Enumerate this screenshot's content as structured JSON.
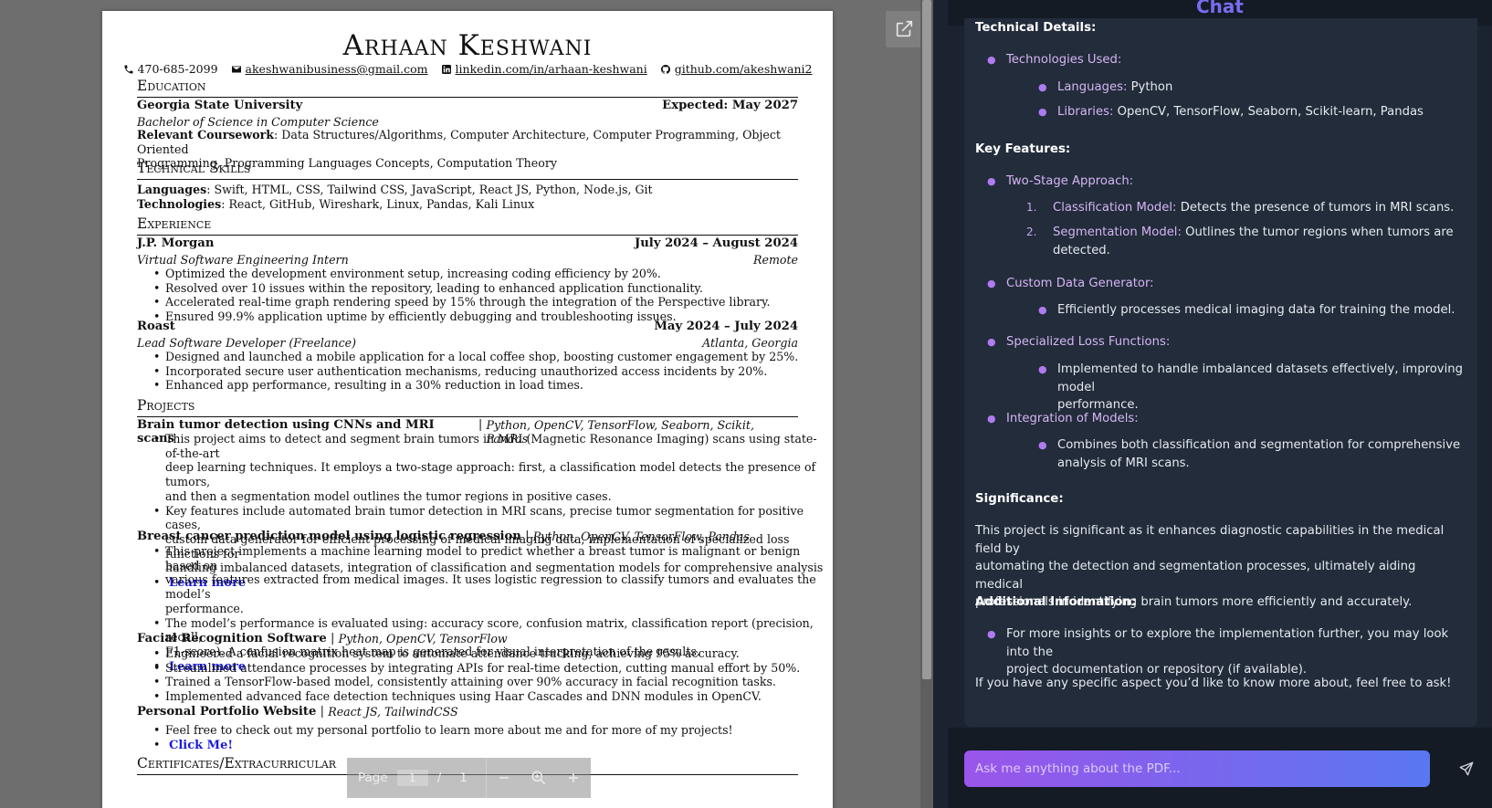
{
  "viewer": {
    "resume": {
      "name": "Arhaan Keshwani",
      "contact": {
        "phone": "470-685-2099",
        "email": "akeshwanibusiness@gmail.com",
        "linkedin": "linkedin.com/in/arhaan-keshwani",
        "github": "github.com/akeshwani2"
      },
      "education": {
        "heading": "Education",
        "school": "Georgia State University",
        "date": "Expected: May 2027",
        "degree": "Bachelor of Science in Computer Science",
        "coursework_label": "Relevant Coursework",
        "coursework_l1": ": Data Structures/Algorithms, Computer Architecture, Computer Programming, Object Oriented",
        "coursework_l2": "Programming, Programming Languages Concepts, Computation Theory"
      },
      "skills": {
        "heading": "Technical Skills",
        "languages_label": "Languages",
        "languages": ": Swift, HTML, CSS, Tailwind CSS, JavaScript, React JS, Python, Node.js, Git",
        "technologies_label": "Technologies",
        "technologies": ": React, GitHub, Wireshark, Linux, Pandas, Kali Linux"
      },
      "experience": {
        "heading": "Experience",
        "jobs": [
          {
            "company": "J.P. Morgan",
            "date": "July 2024 – August 2024",
            "role": "Virtual Software Engineering Intern",
            "location": "Remote",
            "bullets": [
              "Optimized the development environment setup, increasing coding efficiency by 20%.",
              "Resolved over 10 issues within the repository, leading to enhanced application functionality.",
              "Accelerated real-time graph rendering speed by 15% through the integration of the Perspective library.",
              "Ensured 99.9% application uptime by efficiently debugging and troubleshooting issues."
            ]
          },
          {
            "company": "Roast",
            "date": "May 2024 – July 2024",
            "role": "Lead Software Developer (Freelance)",
            "location": "Atlanta, Georgia",
            "bullets": [
              "Designed and launched a mobile application for a local coffee shop, boosting customer engagement by 25%.",
              "Incorporated secure user authentication mechanisms, reducing unauthorized access incidents by 20%.",
              "Enhanced app performance, resulting in a 30% reduction in load times."
            ]
          }
        ]
      },
      "projects": {
        "heading": "Projects",
        "items": [
          {
            "title": "Brain tumor detection using CNNs and MRI scans",
            "sep": " | ",
            "stack": "Python, OpenCV, TensorFlow, Seaborn, Scikit, Pandas",
            "bullets": [
              [
                "This project aims to detect and segment brain tumors in MRI (Magnetic Resonance Imaging) scans using state-of-the-art",
                "deep learning techniques. It employs a two-stage approach: first, a classification model detects the presence of tumors,",
                "and then a segmentation model outlines the tumor regions in positive cases."
              ],
              [
                "Key features include automated brain tumor detection in MRI scans, precise tumor segmentation for positive cases,",
                "custom data generator for efficient processing of medical imaging data, implementation of specialized loss functions for",
                "handling imbalanced datasets, integration of classification and segmentation models for comprehensive analysis"
              ]
            ],
            "link": "Learn more"
          },
          {
            "title": "Breast cancer prediction model using logistic regression",
            "sep": " | ",
            "stack": "Python, OpenCV, TensorFlow, Pandas",
            "bullets": [
              [
                "This project implements a machine learning model to predict whether a breast tumor is malignant or benign based on",
                "various features extracted from medical images. It uses logistic regression to classify tumors and evaluates the model’s",
                "performance."
              ],
              [
                "The model’s performance is evaluated using: accuracy score, confusion matrix, classification report (precision, recall,",
                "F1-score). A confusion matrix heat map is generated for visual interpretation of the results."
              ]
            ],
            "link": "Learn more"
          },
          {
            "title": "Facial Recognition Software",
            "sep": " | ",
            "stack": "Python, OpenCV, TensorFlow",
            "bullets": [
              "Engineered a facial recognition system to automate attendance tracking, achieving 95% accuracy.",
              "Streamlined attendance processes by integrating APIs for real-time detection, cutting manual effort by 50%.",
              "Trained a TensorFlow-based model, consistently attaining over 90% accuracy in facial recognition tasks.",
              "Implemented advanced face detection techniques using Haar Cascades and DNN modules in OpenCV."
            ]
          },
          {
            "title": "Personal Portfolio Website",
            "sep": " | ",
            "stack": "React JS, TailwindCSS",
            "bullets": [
              "Feel free to check out my personal portfolio to learn more about me and for more of my projects!"
            ],
            "link": "Click Me!"
          }
        ]
      },
      "certificates_heading": "Certificates/Extracurricular"
    },
    "controls": {
      "page_label": "Page",
      "current_page": "1",
      "separator": "/",
      "total_pages": "1"
    }
  },
  "chat": {
    "title": "Chat",
    "sections": {
      "technical_details": "Technical Details:",
      "technologies_used": "Technologies Used:",
      "languages_label": "Languages:",
      "languages_value": " Python",
      "libraries_label": "Libraries:",
      "libraries_value": " OpenCV, TensorFlow, Seaborn, Scikit-learn, Pandas",
      "key_features": "Key Features:",
      "two_stage": "Two-Stage Approach:",
      "classification_label": "Classification Model:",
      "classification_value": " Detects the presence of tumors in MRI scans.",
      "segmentation_label": "Segmentation Model:",
      "segmentation_value_1": " Outlines the tumor regions when tumors are",
      "segmentation_value_2": "detected.",
      "custom_data": "Custom Data Generator:",
      "custom_data_value": "Efficiently processes medical imaging data for training the model.",
      "loss_functions": "Specialized Loss Functions:",
      "loss_value_1": "Implemented to handle imbalanced datasets effectively, improving model",
      "loss_value_2": "performance.",
      "integration": "Integration of Models:",
      "integration_value_1": "Combines both classification and segmentation for comprehensive",
      "integration_value_2": "analysis of MRI scans.",
      "significance": "Significance:",
      "significance_1": "This project is significant as it enhances diagnostic capabilities in the medical field by",
      "significance_2": "automating the detection and segmentation processes, ultimately aiding medical",
      "significance_3": "professionals in identifying brain tumors more efficiently and accurately.",
      "additional": "Additional Information:",
      "additional_1": "For more insights or to explore the implementation further, you may look into the",
      "additional_2": "project documentation or repository (if available).",
      "closing": "If you have any specific aspect you’d like to know more about, feel free to ask!"
    },
    "input_placeholder": "Ask me anything about the PDF..."
  },
  "icons": {
    "phone": "phone-icon",
    "email": "envelope-icon",
    "linkedin": "linkedin-icon",
    "github": "github-icon",
    "open_external": "open-external-icon",
    "zoom_out": "minus-icon",
    "zoom": "zoom-icon",
    "zoom_in": "plus-icon",
    "send": "send-icon"
  },
  "colors": {
    "chat_title": "#7a6cf2",
    "bullet_accent": "#b07af0",
    "link": "#1a1adb",
    "input_gradient_start": "#9a55ea",
    "input_gradient_end": "#5a77f2"
  }
}
